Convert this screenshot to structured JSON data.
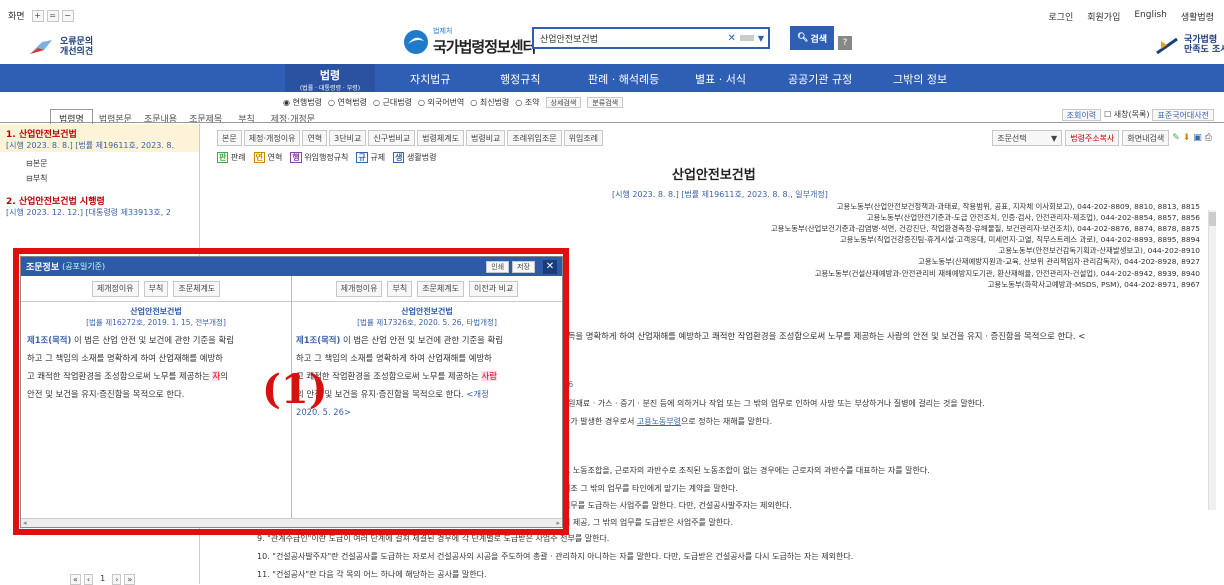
{
  "top": {
    "zoom_label": "화면",
    "zoom_btns": [
      "+",
      "=",
      "−"
    ],
    "links": [
      "로그인",
      "회원가입",
      "English",
      "생활법령"
    ]
  },
  "logo": {
    "small": "법제처",
    "name": "국가법령정보센터",
    "left": "오류문의\n개선의견",
    "right": "국가법령\n만족도 조사"
  },
  "search": {
    "value": "산업안전보건법",
    "clear": "✕",
    "button": "검색",
    "help": "?"
  },
  "nav": {
    "items": [
      {
        "label": "법령",
        "sub": "(법률 · 대통령령 · 부령)"
      },
      {
        "label": "자치법규"
      },
      {
        "label": "행정규칙"
      },
      {
        "label": "판례 · 해석례등"
      },
      {
        "label": "별표 · 서식"
      },
      {
        "label": "공공기관 규정"
      },
      {
        "label": "그밖의 정보"
      }
    ]
  },
  "radios": [
    "현행법령",
    "연혁법령",
    "근대법령",
    "외국어번역",
    "최신법령",
    "조약"
  ],
  "radio_btns": [
    "상세검색",
    "분류검색"
  ],
  "tabs": [
    "법령명",
    "법령본문",
    "조문내용",
    "조문제목",
    "부칙",
    "제정·개정문"
  ],
  "right_tools": [
    "조회이력",
    "새창(목록)",
    "표준국어대사전"
  ],
  "toolbar": [
    "본문",
    "제정·개정이유",
    "연혁",
    "3단비교",
    "신구법비교",
    "법령체계도",
    "법령비교",
    "조례위임조문",
    "위임조례"
  ],
  "toolbar2": [
    "판례",
    "연혁",
    "위임행정규칙",
    "규제",
    "생활법령"
  ],
  "right_select": "조문선택",
  "right_btns": [
    "법령주소복사",
    "화면내검색"
  ],
  "left": {
    "item1_title": "1. 산업안전보건법",
    "item1_meta": "[시행 2023. 8. 8.] [법률 제19611호, 2023. 8.",
    "item1_sub": [
      "본문",
      "부칙"
    ],
    "item2_title": "2. 산업안전보건법 시행령",
    "item2_meta": "[시행 2023. 12. 12.] [대통령령 제33913호, 2",
    "pager": "1"
  },
  "law": {
    "title": "산업안전보건법",
    "meta": "[시행 2023. 8. 8.] [법률 제19611호, 2023. 8. 8., 일부개정]",
    "depts": [
      "고용노동부(산업안전보건정책과-과태료, 작용범위, 공표, 지자체 이사회보고), 044-202-8809, 8810, 8813, 8815",
      "고용노동부(산업안전기준과-도급 안전조치, 인증·검사, 안전관리자-제조업), 044-202-8854, 8857, 8856",
      "고용노동부(산업보건기준과-감염병·석면, 건강진단, 작업환경측정·유해물질, 보건관리자·보건조치), 044-202-8876, 8874, 8878, 8875",
      "고용노동부(직업건강증진팀-휴게시설·고객응대, 미세먼지·고열, 직무스트레스 과로), 044-202-8893, 8895, 8894",
      "고용노동부(안전보건감독기획과-산재발생보고), 044-202-8910",
      "고용노동부(산재예방지원과-교육, 산보위 관리책임자·관리감독자), 044-202-8928, 8927",
      "고용노동부(건설산재예방과-안전관리비 재해예방지도기관, 환산재해율, 안전관리자-건설업), 044-202-8942, 8939, 8940",
      "고용노동부(화학사고예방과-MSDS, PSM), 044-202-8971, 8967"
    ],
    "body": [
      "소득을 명확하게 하여 산업재해를 예방하고 쾌적한 작업환경을 조성함으로써 노무를 제공하는 사람의 안전 및 보건을 유지 · 증진함을 목적으로 한다. <",
      "26",
      "· 원재료 · 가스 · 증기 · 분진 등에 의하거나 작업 또는 그 밖의 업무로 인하여 사망 또는 부상하거나 질병에 걸리는 것을 말한다.",
      "자가 발생한 경우로서 ",
      "고용노동부령",
      "으로 정하는 재해를 말한다.",
      "그 노동조합을, 근로자의 과반수로 조직된 노동조합이 없는 경우에는 근로자의 과반수를 대표하는 자를 말한다.",
      "제조 그 밖의 업무를 타인에게 맡기는 계약을 말한다.",
      "업무를 도급하는 사업주를 말한다. 다만, 건설공사발주자는 제외한다.",
      "의 제공, 그 밖의 업무를 도급받은 사업주를 말한다.",
      "9. \"관계수급인\"이란 도급이 여러 단계에 걸쳐 체결된 경우에 각 단계별로 도급받은 사업주 전부를 말한다.",
      "10. \"건설공사발주자\"란 건설공사를 도급하는 자로서 건설공사의 시공을 주도하여 총괄 · 관리하지 아니하는 자를 말한다. 다만, 도급받은 건설공사를 다시 도급하는 자는 제외한다.",
      "11. \"건설공사\"란 다음 각 목의 어느 하나에 해당하는 공사를 말한다."
    ]
  },
  "popup": {
    "title": "조문정보",
    "title_sub": "(공포일기준)",
    "print": "인쇄",
    "save": "저장",
    "close": "✕",
    "left": {
      "btns": [
        "제개정이유",
        "부칙",
        "조문체계도"
      ],
      "law": "산업안전보건법",
      "meta": "[법률 제16272호, 2019. 1. 15, 전부개정]",
      "art": "제1조(목적)",
      "text1": " 이 법은 산업 안전 및 보건에 관한 기준을 확립",
      "text2": "하고 그 책임의 소재를 명확하게 하여 산업재해를 예방하",
      "text3": "고 쾌적한 작업환경을 조성함으로써 노무를 제공하는 ",
      "hl": "자",
      "text4": "의",
      "text5": "안전 및 보건을 유지·증진함을 목적으로 한다."
    },
    "right": {
      "btns": [
        "제개정이유",
        "부칙",
        "조문체계도",
        "이전과 비교"
      ],
      "law": "산업안전보건법",
      "meta": "[법률 제17326호, 2020. 5. 26, 타법개정]",
      "art": "제1조(목적)",
      "text1": " 이 법은 산업 안전 및 보건에 관한 기준을 확립",
      "text2": "하고 그 책임의 소재를 명확하게 하여 산업재해를 예방하",
      "text3": "고 쾌적한 작업환경을 조성함으로써 노무를 제공하는 ",
      "hl": "사람",
      "text5": "의 안전 및 보건을 유지·증진함을 목적으로 한다.",
      "amend": " <개정",
      "amend2": "2020. 5. 26>"
    }
  },
  "marker": "(1)",
  "colors": {
    "nav": "#2f5fb5",
    "red_box": "#e01010",
    "popup_title": "#2d5ba8"
  }
}
